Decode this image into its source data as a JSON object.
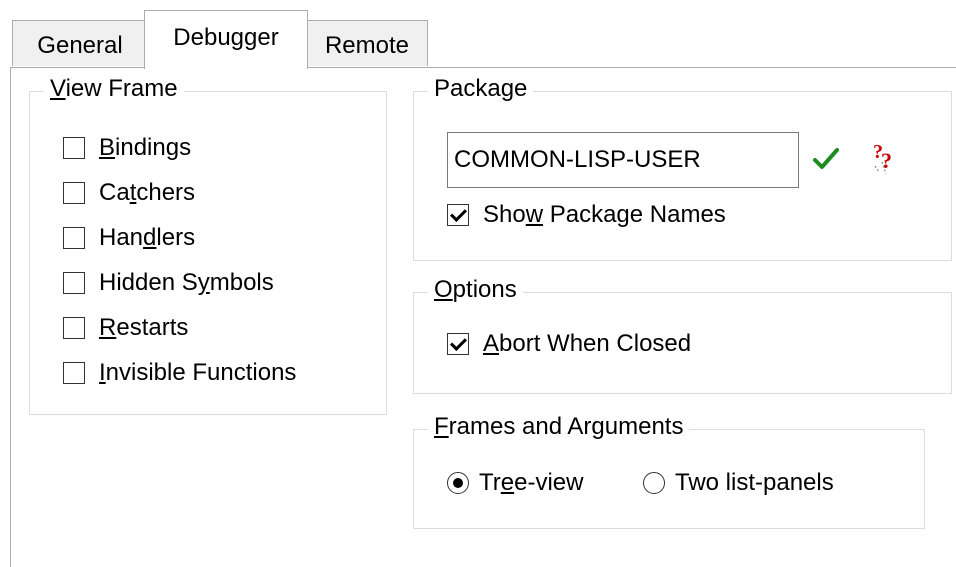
{
  "tabs": [
    {
      "label": "General",
      "active": false
    },
    {
      "label": "Debugger",
      "active": true
    },
    {
      "label": "Remote",
      "active": false
    }
  ],
  "view_frame": {
    "title": "View Frame",
    "items": [
      {
        "label": "Bindings",
        "checked": false
      },
      {
        "label": "Catchers",
        "checked": false
      },
      {
        "label": "Handlers",
        "checked": false
      },
      {
        "label": "Hidden Symbols",
        "checked": false
      },
      {
        "label": "Restarts",
        "checked": false
      },
      {
        "label": "Invisible Functions",
        "checked": false
      }
    ]
  },
  "package": {
    "title": "Package",
    "value": "COMMON-LISP-USER",
    "show_names_label": "Show Package Names",
    "show_names_checked": true,
    "icons": [
      "check-icon",
      "help-icon"
    ]
  },
  "options": {
    "title": "Options",
    "abort_label": "Abort When Closed",
    "abort_checked": true
  },
  "frames": {
    "title": "Frames and Arguments",
    "options": [
      {
        "label": "Tree-view",
        "selected": true
      },
      {
        "label": "Two list-panels",
        "selected": false
      }
    ]
  },
  "colors": {
    "check_green": "#1e8c1e",
    "help_red": "#cc0000",
    "tab_bg": "#f0f0f0",
    "border": "#adadad"
  }
}
